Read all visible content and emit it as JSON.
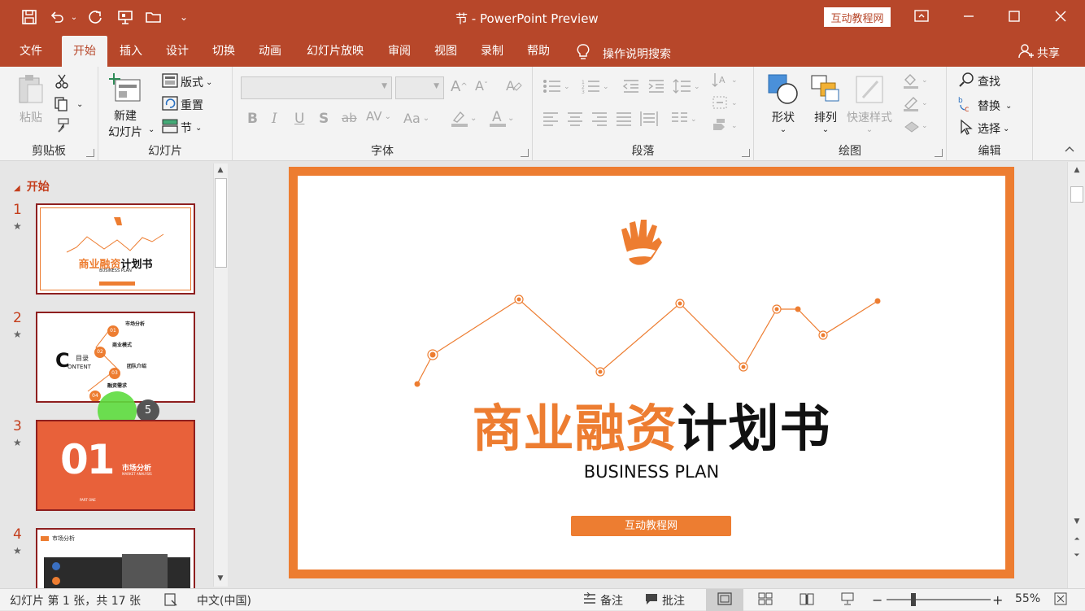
{
  "app": {
    "doc_title": "节 - PowerPoint Preview",
    "brand_label": "互动教程网",
    "qat_dropdown": "⌄"
  },
  "tabs": [
    {
      "label": "文件"
    },
    {
      "label": "开始"
    },
    {
      "label": "插入"
    },
    {
      "label": "设计"
    },
    {
      "label": "切换"
    },
    {
      "label": "动画"
    },
    {
      "label": "幻灯片放映"
    },
    {
      "label": "审阅"
    },
    {
      "label": "视图"
    },
    {
      "label": "录制"
    },
    {
      "label": "帮助"
    }
  ],
  "tellme": "操作说明搜索",
  "share": "共享",
  "ribbon": {
    "clipboard": {
      "label": "剪贴板",
      "paste": "粘贴"
    },
    "slides": {
      "label": "幻灯片",
      "new_slide_1": "新建",
      "new_slide_2": "幻灯片",
      "layout": "版式",
      "reset": "重置",
      "section": "节"
    },
    "font": {
      "label": "字体",
      "grow": "A^",
      "shrink": "Aˇ",
      "bold": "B",
      "italic": "I",
      "underline": "U",
      "shadow": "S",
      "strike": "ab",
      "spacing": "AV",
      "case": "Aa",
      "color": "A"
    },
    "paragraph": {
      "label": "段落"
    },
    "drawing": {
      "label": "绘图",
      "shapes": "形状",
      "arrange": "排列",
      "quick_styles": "快速样式"
    },
    "editing": {
      "label": "编辑",
      "find": "查找",
      "replace": "替换",
      "select": "选择"
    }
  },
  "sidebar": {
    "section_title": "开始",
    "slides": [
      {
        "num": "1",
        "star": "★"
      },
      {
        "num": "2",
        "star": "★"
      },
      {
        "num": "3",
        "star": "★"
      },
      {
        "num": "4",
        "star": "★"
      }
    ],
    "badge": "5",
    "thumb1": {
      "title_orange": "商业融资",
      "title_black": "计划书",
      "sub": "BUSINESS PLAN"
    },
    "thumb2": {
      "c_letter": "C",
      "mulu": "目录",
      "ontent": "ONTENT",
      "items": [
        {
          "num": "01",
          "title": "市场分析",
          "sub": "MARKET ANALYSIS"
        },
        {
          "num": "02",
          "title": "商业模式",
          "sub": "BUSINESS MODEL"
        },
        {
          "num": "03",
          "title": "团队介绍",
          "sub": "TEAM INTRODUCTION"
        },
        {
          "num": "04",
          "title": "融资需求",
          "sub": "FINANCING NEEDS"
        }
      ]
    },
    "thumb3": {
      "big": "01",
      "title": "市场分析",
      "sub": "MARKET ANALYSIS",
      "part": "PART ONE"
    },
    "thumb4": {
      "title": "市场分析"
    }
  },
  "slide": {
    "title_orange": "商业融资",
    "title_black": "计划书",
    "subtitle": "BUSINESS PLAN",
    "button_label": "互动教程网",
    "colors": {
      "orange": "#ed7d31",
      "frame": "#ed7d31",
      "accent": "#b7472a"
    }
  },
  "status": {
    "slide_info": "幻灯片 第 1 张，共 17 张",
    "language": "中文(中国)",
    "notes": "备注",
    "comments": "批注",
    "zoom": "55%"
  }
}
